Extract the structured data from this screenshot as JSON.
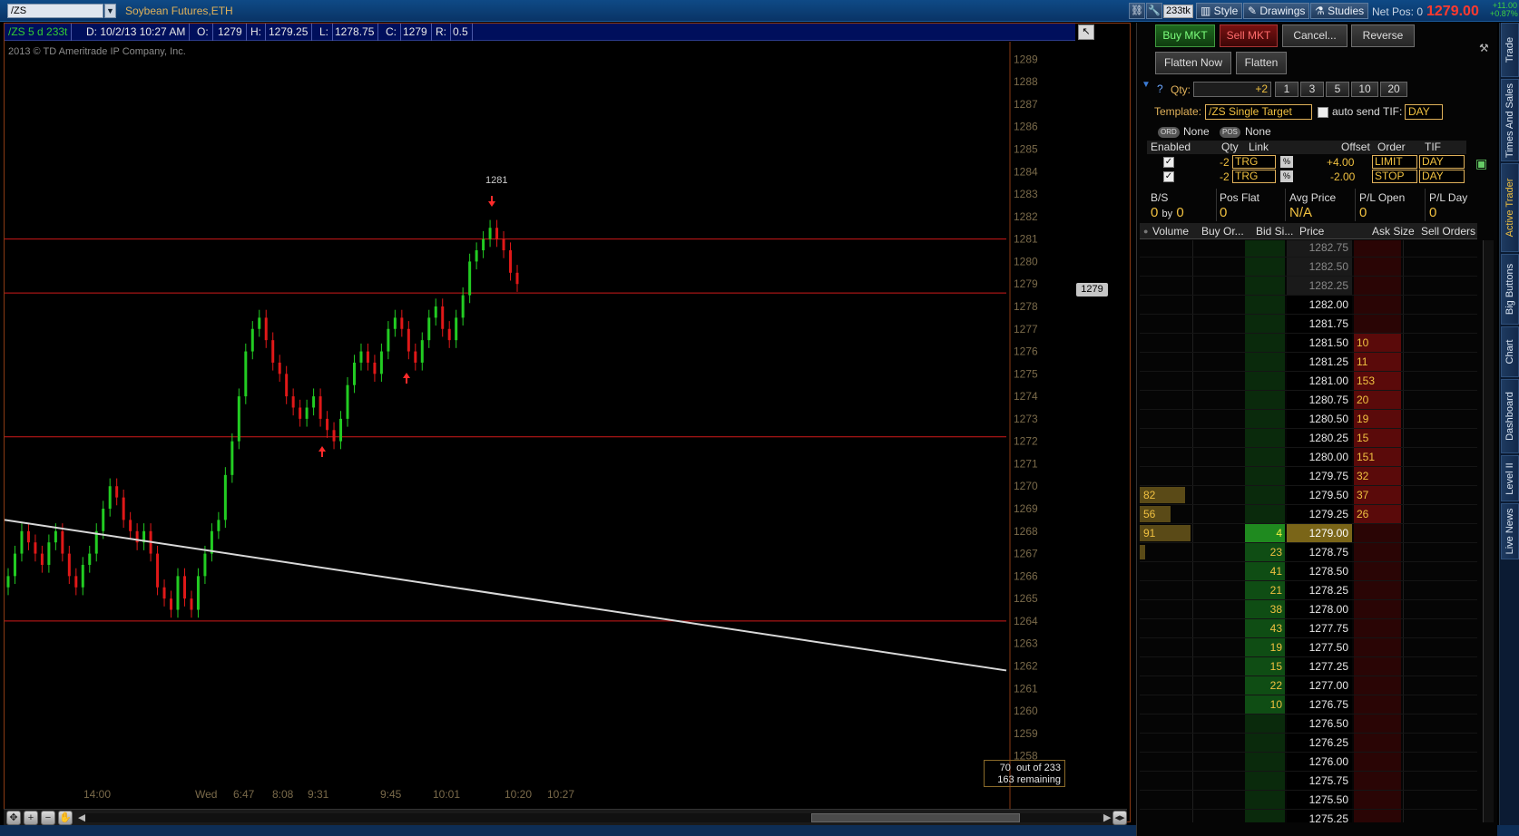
{
  "topbar": {
    "symbol": "/ZS",
    "description": "Soybean Futures,ETH",
    "tick_badge": "233tk",
    "style_label": "Style",
    "drawings_label": "Drawings",
    "studies_label": "Studies",
    "net_pos": "Net Pos: 0",
    "last_price": "1279.00",
    "change_abs": "+11.00",
    "change_pct": "+0.87%"
  },
  "chart": {
    "header": {
      "symbol": "/ZS 5 d 233t",
      "date": "D: 10/2/13 10:27 AM",
      "open_lbl": "O:",
      "open": "1279",
      "high_lbl": "H:",
      "high": "1279.25",
      "low_lbl": "L:",
      "low": "1278.75",
      "close_lbl": "C:",
      "close": "1279",
      "range_lbl": "R:",
      "range": "0.5"
    },
    "copyright": "2013 © TD Ameritrade IP Company, Inc.",
    "current_price_tag": "1279",
    "peak_label": "1281",
    "bars_shown": "70",
    "bars_out_of": "out of 233",
    "bars_remaining": "163 remaining",
    "y_ticks": [
      "1289",
      "1288",
      "1287",
      "1286",
      "1285",
      "1284",
      "1283",
      "1282",
      "1281",
      "1280",
      "1279",
      "1278",
      "1277",
      "1276",
      "1275",
      "1274",
      "1273",
      "1272",
      "1271",
      "1270",
      "1269",
      "1268",
      "1267",
      "1266",
      "1265",
      "1264",
      "1263",
      "1262",
      "1261",
      "1260",
      "1259",
      "1258"
    ],
    "x_ticks": [
      "14:00",
      "Wed",
      "6:47",
      "8:08",
      "9:31",
      "9:45",
      "10:01",
      "10:20",
      "10:27"
    ],
    "colors": {
      "up": "#22cc22",
      "down": "#e01818",
      "hline": "#d01a1a",
      "trendline": "#d8d8d8"
    }
  },
  "chart_data": {
    "type": "candlestick",
    "title": "/ZS 5 d 233t",
    "ylim": [
      1257.5,
      1289.5
    ],
    "horizontal_lines": [
      1281,
      1278.6,
      1272.2,
      1264
    ],
    "trendline": {
      "from": [
        0,
        1268.5
      ],
      "to": [
        236,
        1261.8
      ]
    },
    "closes": [
      1266,
      1267,
      1268,
      1267.5,
      1267,
      1266.5,
      1267.5,
      1268,
      1267,
      1266,
      1265.5,
      1266.5,
      1267,
      1268,
      1269,
      1270,
      1269.5,
      1268.5,
      1268,
      1267.5,
      1268,
      1267,
      1265.5,
      1265,
      1264.5,
      1266,
      1265,
      1264.5,
      1266,
      1267,
      1268,
      1268.5,
      1270.5,
      1272,
      1274,
      1276,
      1277,
      1277.5,
      1276.5,
      1275.5,
      1275,
      1274,
      1273.5,
      1273,
      1273.5,
      1274,
      1273,
      1272.5,
      1272,
      1273,
      1274.5,
      1275.5,
      1276,
      1275.5,
      1275,
      1276,
      1277,
      1277.5,
      1277,
      1276,
      1275.5,
      1276.5,
      1277.5,
      1278,
      1277,
      1276.5,
      1277.5,
      1278.5,
      1280,
      1280.5,
      1281,
      1281.5,
      1281,
      1280.5,
      1279.5,
      1279
    ]
  },
  "order_panel": {
    "buy_mkt": "Buy MKT",
    "sell_mkt": "Sell MKT",
    "cancel": "Cancel...",
    "reverse": "Reverse",
    "flatten_now": "Flatten Now",
    "flatten": "Flatten",
    "qty_label": "Qty:",
    "qty_value": "+2",
    "qty_presets": [
      "1",
      "3",
      "5",
      "10",
      "20"
    ],
    "template_label": "Template:",
    "template_value": "/ZS Single Target",
    "auto_send": "auto send",
    "tif_label": "TIF:",
    "tif_value": "DAY",
    "ord_badge": "ORD",
    "ord_value": "None",
    "pos_badge": "POS",
    "pos_value": "None",
    "bracket_headers": {
      "enabled": "Enabled",
      "qty": "Qty",
      "link": "Link",
      "offset": "Offset",
      "order": "Order",
      "tif": "TIF"
    },
    "brackets": [
      {
        "qty": "-2",
        "link": "TRG",
        "offset": "+4.00",
        "order": "LIMIT",
        "tif": "DAY"
      },
      {
        "qty": "-2",
        "link": "TRG",
        "offset": "-2.00",
        "order": "STOP",
        "tif": "DAY"
      }
    ],
    "stats": {
      "bs_label": "B/S",
      "bs_buy": "0",
      "bs_by": "by",
      "bs_sell": "0",
      "posflat_label": "Pos Flat",
      "posflat_value": "0",
      "avg_label": "Avg Price",
      "avg_value": "N/A",
      "plopen_label": "P/L Open",
      "plopen_value": "0",
      "plday_label": "P/L Day",
      "plday_value": "0"
    }
  },
  "ladder": {
    "headers": {
      "volume": "Volume",
      "buy_orders": "Buy Or...",
      "bid_size": "Bid Si...",
      "price": "Price",
      "ask_size": "Ask Size",
      "sell_orders": "Sell Orders"
    },
    "rows": [
      {
        "price": "1282.75",
        "volume": "",
        "bid": "",
        "ask": ""
      },
      {
        "price": "1282.50",
        "volume": "",
        "bid": "",
        "ask": ""
      },
      {
        "price": "1282.25",
        "volume": "",
        "bid": "",
        "ask": ""
      },
      {
        "price": "1282.00",
        "volume": "",
        "bid": "",
        "ask": ""
      },
      {
        "price": "1281.75",
        "volume": "",
        "bid": "",
        "ask": ""
      },
      {
        "price": "1281.50",
        "volume": "",
        "bid": "",
        "ask": "10"
      },
      {
        "price": "1281.25",
        "volume": "",
        "bid": "",
        "ask": "11"
      },
      {
        "price": "1281.00",
        "volume": "",
        "bid": "",
        "ask": "153"
      },
      {
        "price": "1280.75",
        "volume": "",
        "bid": "",
        "ask": "20"
      },
      {
        "price": "1280.50",
        "volume": "",
        "bid": "",
        "ask": "19"
      },
      {
        "price": "1280.25",
        "volume": "",
        "bid": "",
        "ask": "15"
      },
      {
        "price": "1280.00",
        "volume": "",
        "bid": "",
        "ask": "151"
      },
      {
        "price": "1279.75",
        "volume": "",
        "bid": "",
        "ask": "32"
      },
      {
        "price": "1279.50",
        "volume": "82",
        "bid": "",
        "ask": "37"
      },
      {
        "price": "1279.25",
        "volume": "56",
        "bid": "",
        "ask": "26"
      },
      {
        "price": "1279.00",
        "volume": "91",
        "bid": "4",
        "ask": ""
      },
      {
        "price": "1278.75",
        "volume": "",
        "bid": "23",
        "ask": ""
      },
      {
        "price": "1278.50",
        "volume": "",
        "bid": "41",
        "ask": ""
      },
      {
        "price": "1278.25",
        "volume": "",
        "bid": "21",
        "ask": ""
      },
      {
        "price": "1278.00",
        "volume": "",
        "bid": "38",
        "ask": ""
      },
      {
        "price": "1277.75",
        "volume": "",
        "bid": "43",
        "ask": ""
      },
      {
        "price": "1277.50",
        "volume": "",
        "bid": "19",
        "ask": ""
      },
      {
        "price": "1277.25",
        "volume": "",
        "bid": "15",
        "ask": ""
      },
      {
        "price": "1277.00",
        "volume": "",
        "bid": "22",
        "ask": ""
      },
      {
        "price": "1276.75",
        "volume": "",
        "bid": "10",
        "ask": ""
      },
      {
        "price": "1276.50",
        "volume": "",
        "bid": "",
        "ask": ""
      },
      {
        "price": "1276.25",
        "volume": "",
        "bid": "",
        "ask": ""
      },
      {
        "price": "1276.00",
        "volume": "",
        "bid": "",
        "ask": ""
      },
      {
        "price": "1275.75",
        "volume": "",
        "bid": "",
        "ask": ""
      },
      {
        "price": "1275.50",
        "volume": "",
        "bid": "",
        "ask": ""
      },
      {
        "price": "1275.25",
        "volume": "",
        "bid": "",
        "ask": ""
      }
    ]
  },
  "side_tabs": [
    "Trade",
    "Times And Sales",
    "Active Trader",
    "Big Buttons",
    "Chart",
    "Dashboard",
    "Level II",
    "Live News"
  ]
}
